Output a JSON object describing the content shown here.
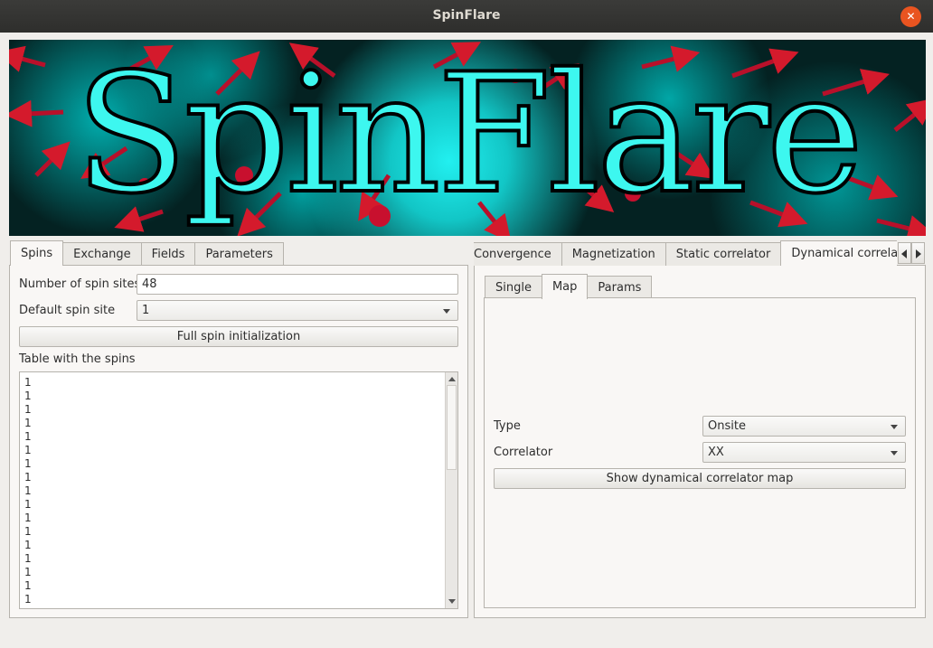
{
  "window": {
    "title": "SpinFlare",
    "close_symbol": "✕"
  },
  "banner": {
    "text": "SpinFlare"
  },
  "left_panel": {
    "tabs": [
      "Spins",
      "Exchange",
      "Fields",
      "Parameters"
    ],
    "active_tab": "Spins",
    "num_spin_sites_label": "Number of spin sites",
    "num_spin_sites_value": "48",
    "default_spin_site_label": "Default spin site",
    "default_spin_site_value": "1",
    "full_init_button": "Full spin initialization",
    "table_label": "Table with the spins",
    "spin_rows": [
      "1",
      "1",
      "1",
      "1",
      "1",
      "1",
      "1",
      "1",
      "1",
      "1",
      "1",
      "1",
      "1",
      "1",
      "1",
      "1",
      "1"
    ]
  },
  "right_panel": {
    "tabs": [
      "Convergence",
      "Magnetization",
      "Static correlator",
      "Dynamical correlator"
    ],
    "active_tab": "Dynamical correlator",
    "sub_tabs": [
      "Single",
      "Map",
      "Params"
    ],
    "active_sub_tab": "Map",
    "type_label": "Type",
    "type_value": "Onsite",
    "correlator_label": "Correlator",
    "correlator_value": "XX",
    "show_map_button": "Show dynamical correlator map"
  },
  "colors": {
    "accent_close": "#e95420",
    "banner_text": "#3df7ef",
    "banner_arrows": "#c8102e",
    "titlebar": "#2e2e2c"
  }
}
